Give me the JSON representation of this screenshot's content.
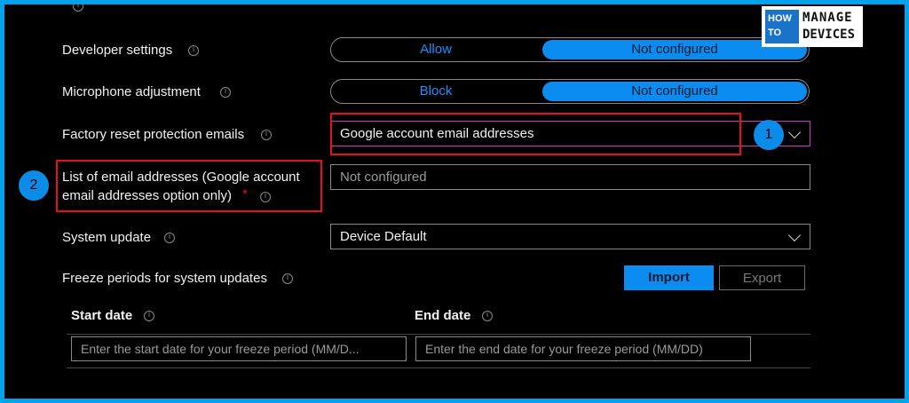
{
  "logo": {
    "how": "HOW",
    "to": "TO",
    "manage": "MANAGE",
    "devices": "DEVICES"
  },
  "rows": {
    "developer": {
      "label": "Developer settings",
      "option_a": "Allow",
      "option_b": "Not configured"
    },
    "microphone": {
      "label": "Microphone adjustment",
      "option_a": "Block",
      "option_b": "Not configured"
    },
    "frp": {
      "label": "Factory reset protection emails",
      "value": "Google account email addresses"
    },
    "email_list": {
      "label_line1": "List of email addresses (Google account",
      "label_line2": "email addresses option only)",
      "required": "*",
      "placeholder": "Not configured"
    },
    "system_update": {
      "label": "System update",
      "value": "Device Default"
    },
    "freeze": {
      "label": "Freeze periods for system updates",
      "import": "Import",
      "export": "Export"
    }
  },
  "table": {
    "start_header": "Start date",
    "end_header": "End date",
    "start_placeholder": "Enter the start date for your freeze period (MM/D...",
    "end_placeholder": "Enter the end date for your freeze period (MM/DD)"
  },
  "badges": [
    "1",
    "2"
  ],
  "colors": {
    "accent": "#0b8cf0",
    "annotation": "#e8101a",
    "background": "#000000"
  }
}
